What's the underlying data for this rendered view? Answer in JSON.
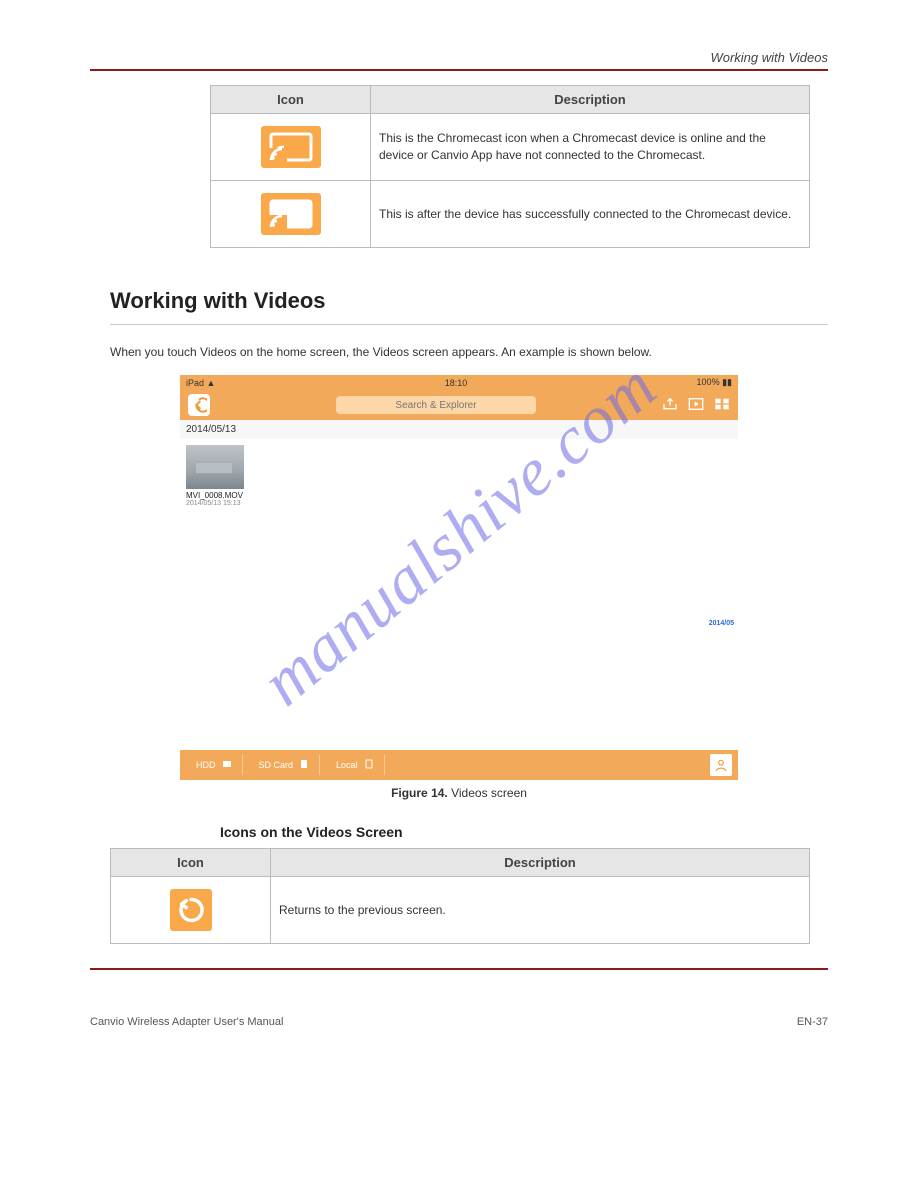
{
  "header": {
    "title": "Working with Videos"
  },
  "table_top": {
    "header_icon": "Icon",
    "header_desc": "Description",
    "rows": [
      {
        "icon": "cast-outline",
        "desc": "This is the Chromecast icon when a Chromecast device is online and the device or Canvio App have not connected to the Chromecast."
      },
      {
        "icon": "cast-filled",
        "desc": "This is after the device has successfully connected to the Chromecast device."
      }
    ]
  },
  "section": {
    "title": "Working with Videos",
    "intro": "When you touch Videos on the home screen, the Videos screen appears. An example is shown below."
  },
  "screenshot": {
    "status": {
      "device": "iPad",
      "wifi": "wifi",
      "time": "18:10",
      "battery": "100%"
    },
    "search_placeholder": "Search & Explorer",
    "date_header": "2014/05/13",
    "thumb": {
      "filename": "MVI_0008.MOV",
      "timestamp": "2014/05/13 15:13"
    },
    "scroll_index": "2014/05",
    "tabs": {
      "hdd": "HDD",
      "sdcard": "SD Card",
      "local": "Local"
    }
  },
  "figure": {
    "label": "Figure 14.",
    "text": "Videos screen"
  },
  "icons_head": "Icons on the Videos Screen",
  "table_bottom": {
    "header_icon": "Icon",
    "header_desc": "Description",
    "rows": [
      {
        "icon": "back",
        "desc": "Returns to the previous screen."
      }
    ]
  },
  "footer": {
    "left": "Canvio Wireless Adapter User's Manual",
    "right": "EN-37"
  },
  "watermark": "manualshive.com"
}
